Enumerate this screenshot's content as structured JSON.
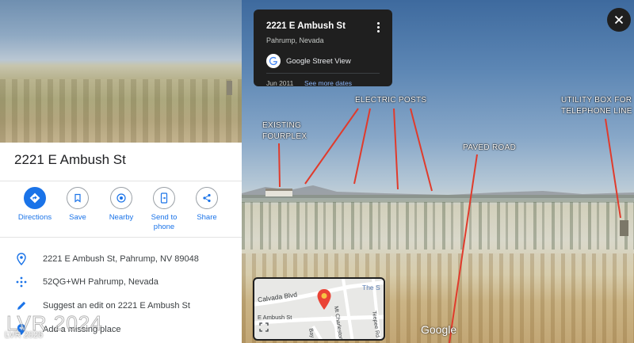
{
  "place": {
    "title": "2221 E Ambush St"
  },
  "actions": [
    {
      "label": "Directions",
      "icon": "directions-icon"
    },
    {
      "label": "Save",
      "icon": "bookmark-icon"
    },
    {
      "label": "Nearby",
      "icon": "nearby-icon"
    },
    {
      "label": "Send to phone",
      "icon": "send-to-phone-icon"
    },
    {
      "label": "Share",
      "icon": "share-icon"
    }
  ],
  "info": {
    "address": "2221 E Ambush St, Pahrump, NV 89048",
    "plus_code": "52QG+WH Pahrump, Nevada",
    "suggest_edit": "Suggest an edit on 2221 E Ambush St",
    "add_missing": "Add a missing place"
  },
  "street_view_card": {
    "title": "2221 E Ambush St",
    "subtitle": "Pahrump, Nevada",
    "source": "Google Street View",
    "date": "Jun 2011",
    "more_dates": "See more dates"
  },
  "annotations": {
    "existing": "EXISTING",
    "fourplex": "FOURPLEX",
    "electric_posts": "ELECTRIC POSTS",
    "paved_road": "PAVED ROAD",
    "utility_line1": "UTILITY BOX FOR",
    "utility_line2": "TELEPHONE LINE"
  },
  "minimap": {
    "calvada": "Calvada Blvd",
    "ambush": "E Ambush St",
    "charleston": "Mt Charleston Dr",
    "teepee": "Teepee Rd",
    "the_s": "The S",
    "bay": "Bay"
  },
  "google_logo": "Google",
  "watermark": {
    "large": "LVR 2024",
    "small": "LVR 2026"
  },
  "colors": {
    "accent_blue": "#1a73e8",
    "annotation_red": "#e03b2c",
    "card_bg": "#1f1f1f",
    "link_blue": "#8ab4f8"
  }
}
